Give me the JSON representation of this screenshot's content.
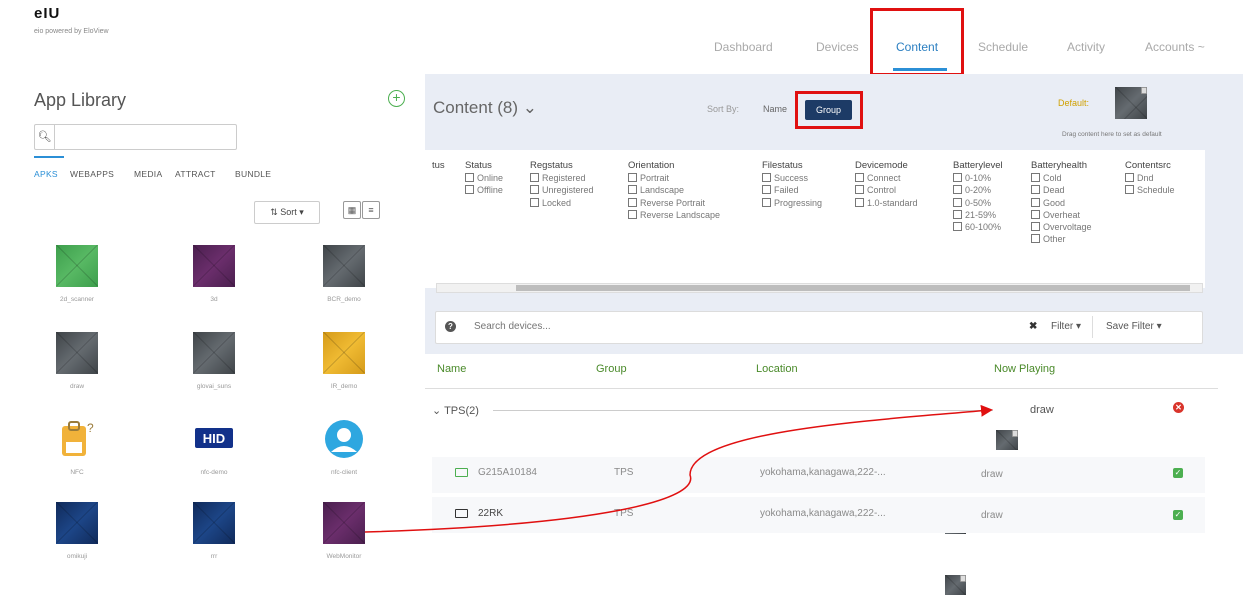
{
  "brand": {
    "logo": "eIU",
    "tagline": "eio powered by EloView"
  },
  "nav": {
    "dashboard": "Dashboard",
    "devices": "Devices",
    "content": "Content",
    "schedule": "Schedule",
    "activity": "Activity",
    "accounts": "Accounts ~"
  },
  "library": {
    "title": "App Library",
    "add_icon": "+",
    "search_placeholder": "",
    "tabs": [
      "APKS",
      "WEBAPPS",
      "MEDIA",
      "ATTRACT",
      "BUNDLE"
    ],
    "sort_label": "Sort ▾",
    "apps": [
      "2d_scanner",
      "3d",
      "BCR_demo",
      "draw",
      "glovai_suns",
      "IR_demo",
      "NFC",
      "nfc-demo",
      "nfc-client",
      "omikuji",
      "rrr",
      "WebMonitor"
    ]
  },
  "content": {
    "title": "Content (8) ⌄",
    "sort_by": "Sort By:",
    "sort_name": "Name",
    "sort_group": "Group",
    "default_label": "Default:",
    "drag_hint": "Drag content here to set as default",
    "filters": [
      {
        "header": "Status",
        "options": [
          "Online",
          "Offline"
        ]
      },
      {
        "header": "Regstatus",
        "options": [
          "Registered",
          "Unregistered",
          "Locked"
        ]
      },
      {
        "header": "Orientation",
        "options": [
          "Portrait",
          "Landscape",
          "Reverse Portrait",
          "Reverse Landscape"
        ]
      },
      {
        "header": "Filestatus",
        "options": [
          "Success",
          "Failed",
          "Progressing"
        ]
      },
      {
        "header": "Devicemode",
        "options": [
          "Connect",
          "Control",
          "1.0-standard"
        ]
      },
      {
        "header": "Batterylevel",
        "options": [
          "0-10%",
          "0-20%",
          "0-50%",
          "21-59%",
          "60-100%"
        ]
      },
      {
        "header": "Batteryhealth",
        "options": [
          "Cold",
          "Dead",
          "Good",
          "Overheat",
          "Overvoltage",
          "Other"
        ]
      },
      {
        "header": "Contentsrc",
        "options": [
          "Dnd",
          "Schedule"
        ]
      }
    ],
    "truncated_col": "tus",
    "search_placeholder": "Search devices...",
    "clear": "✖",
    "filter_btn": "Filter ▾",
    "save_filter_btn": "Save Filter ▾",
    "columns": {
      "name": "Name",
      "group": "Group",
      "location": "Location",
      "now_playing": "Now Playing"
    },
    "group_row": {
      "label": "⌄ TPS(2)",
      "now_playing": "draw"
    },
    "devices": [
      {
        "name": "G215A10184",
        "group": "TPS",
        "location": "yokohama,kanagawa,222-...",
        "now_playing": "draw"
      },
      {
        "name": "22RK",
        "group": "TPS",
        "location": "yokohama,kanagawa,222-...",
        "now_playing": "draw"
      }
    ]
  },
  "colors": {
    "accent": "#2b8fd6",
    "group_btn": "#1d3b66",
    "annotation": "#e01010",
    "ok": "#4caf50",
    "error": "#d9342b"
  }
}
